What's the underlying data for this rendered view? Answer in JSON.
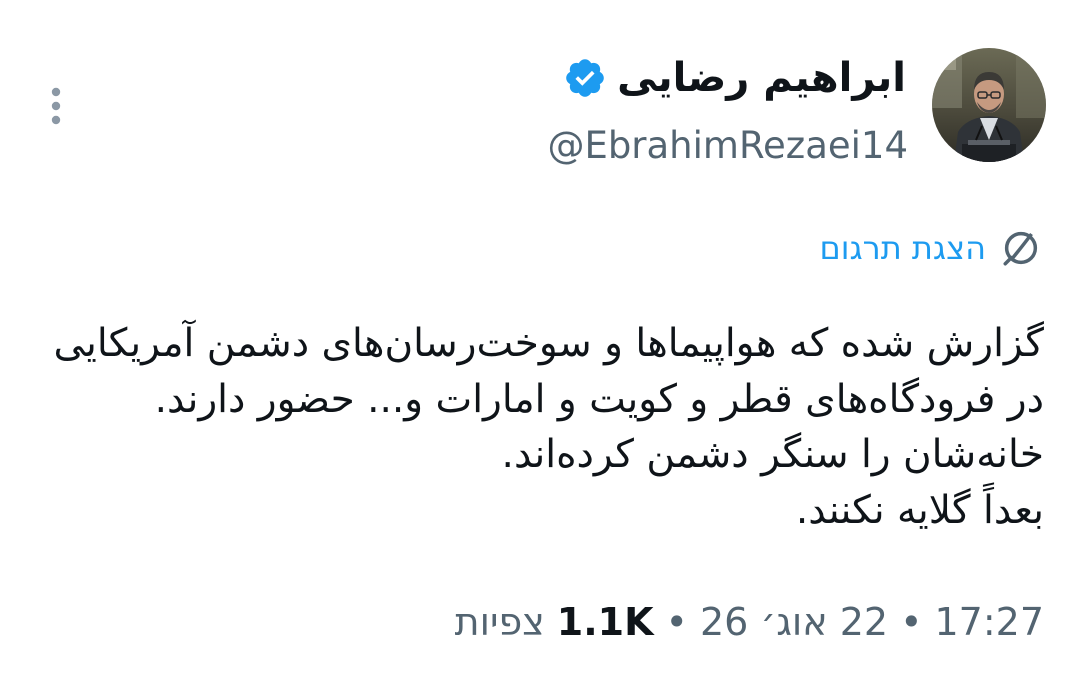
{
  "author": {
    "display_name": "ابراهیم رضایی",
    "handle": "@EbrahimRezaei14",
    "verified_icon": "verified-badge-icon",
    "badge_color": "#1d9bf0"
  },
  "translate": {
    "label": "הצגת תרגום",
    "icon": "globe-icon",
    "color": "#1d9bf0"
  },
  "tweet": {
    "lines": [
      "گزارش شده که هواپیماها و سوخت‌رسان‌های دشمن آمریکایی",
      "در فرودگاه‌های قطر و کویت و امارات و... حضور دارند.",
      "خانه‌شان را سنگر دشمن کرده‌اند.",
      "بعداً گلایه نکنند."
    ]
  },
  "meta": {
    "time": "17:27",
    "date": "22 אוג׳ 26",
    "views_count": "1.1K",
    "views_label": "צפיות",
    "separator": "•"
  },
  "colors": {
    "text": "#0f1419",
    "secondary": "#536471",
    "accent": "#1d9bf0"
  }
}
